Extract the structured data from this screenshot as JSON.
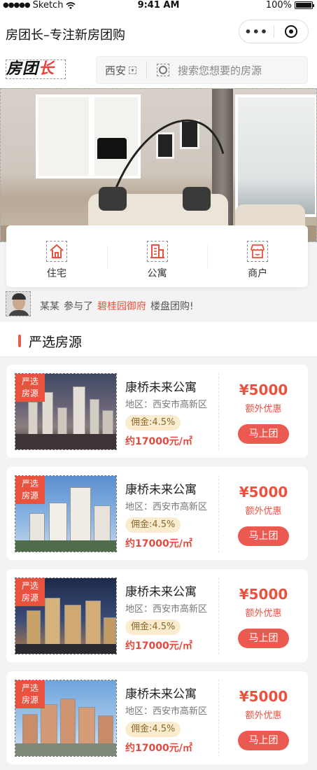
{
  "status_bar": {
    "carrier": "Sketch",
    "time": "9:41 AM",
    "battery": "100%"
  },
  "nav": {
    "title": "房团长–专注新房团购"
  },
  "logo": {
    "text_a": "房团",
    "text_b": "长"
  },
  "search": {
    "city": "西安",
    "placeholder": "搜索您想要的房源"
  },
  "categories": [
    {
      "label": "住宅",
      "icon": "house-icon"
    },
    {
      "label": "公寓",
      "icon": "apartment-icon"
    },
    {
      "label": "商户",
      "icon": "shop-icon"
    }
  ],
  "activity": {
    "user": "某某",
    "verb": "参与了",
    "project": "碧桂园御府",
    "suffix": "楼盘团购!"
  },
  "section": {
    "title": "严选房源"
  },
  "listings": [
    {
      "tag_line1": "严选",
      "tag_line2": "房源",
      "name": "康桥未来公寓",
      "area": "地区：西安市高新区",
      "commission": "佣金:4.5%",
      "price": "约17000元/㎡",
      "bonus": "¥5000",
      "bonus_label": "额外优惠",
      "button": "马上团"
    },
    {
      "tag_line1": "严选",
      "tag_line2": "房源",
      "name": "康桥未来公寓",
      "area": "地区：西安市高新区",
      "commission": "佣金:4.5%",
      "price": "约17000元/㎡",
      "bonus": "¥5000",
      "bonus_label": "额外优惠",
      "button": "马上团"
    },
    {
      "tag_line1": "严选",
      "tag_line2": "房源",
      "name": "康桥未来公寓",
      "area": "地区：西安市高新区",
      "commission": "佣金:4.5%",
      "price": "约17000元/㎡",
      "bonus": "¥5000",
      "bonus_label": "额外优惠",
      "button": "马上团"
    },
    {
      "tag_line1": "严选",
      "tag_line2": "房源",
      "name": "康桥未来公寓",
      "area": "地区：西安市高新区",
      "commission": "佣金:4.5%",
      "price": "约17000元/㎡",
      "bonus": "¥5000",
      "bonus_label": "额外优惠",
      "button": "马上团"
    }
  ],
  "colors": {
    "accent": "#ea5a50",
    "price": "#e24a3d",
    "commission_bg": "#fbeccf"
  }
}
